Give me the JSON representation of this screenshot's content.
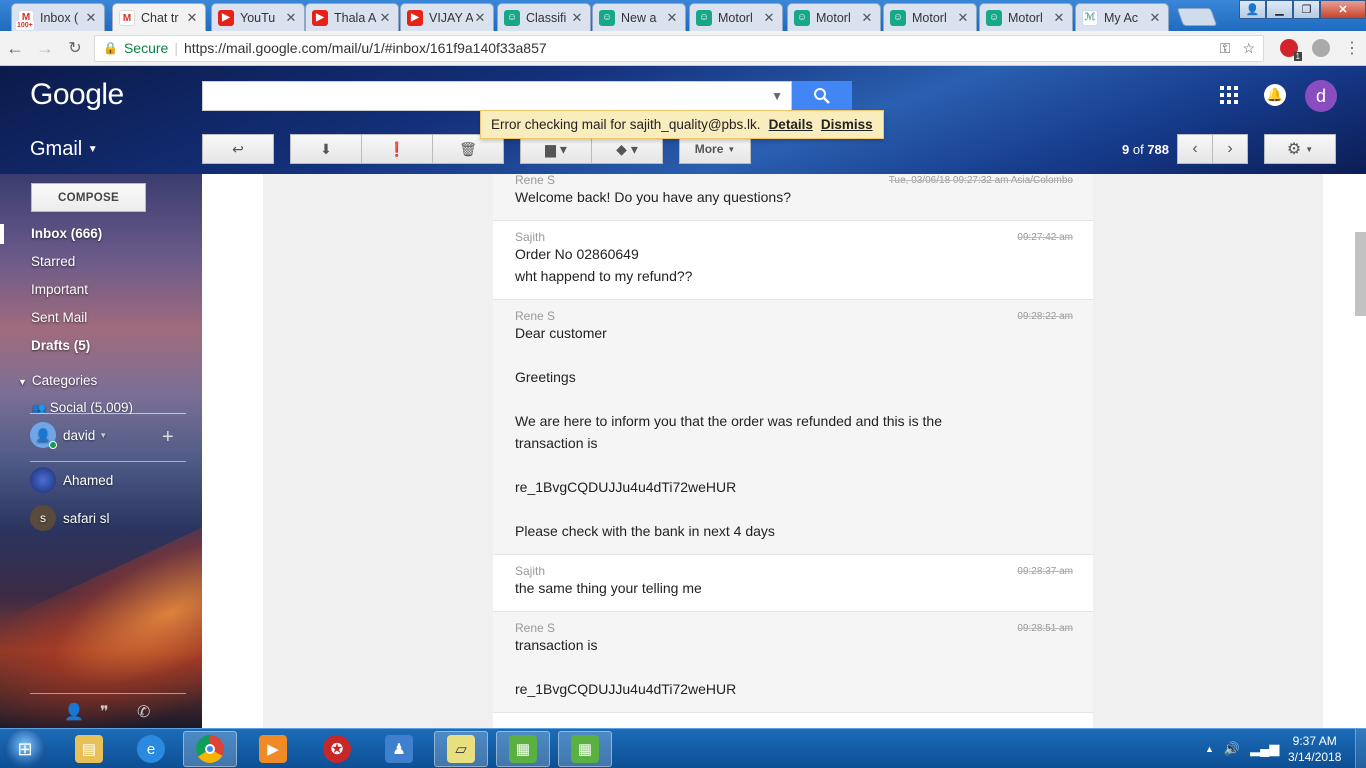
{
  "browser": {
    "tabs": [
      {
        "title": "Inbox (",
        "favicon": "gmail-icon",
        "badge": "100+"
      },
      {
        "title": "Chat tr",
        "favicon": "gmail-icon"
      },
      {
        "title": "YouTu",
        "favicon": "youtube-icon"
      },
      {
        "title": "Thala A",
        "favicon": "youtube-icon"
      },
      {
        "title": "VIJAY A",
        "favicon": "youtube-icon"
      },
      {
        "title": "Classifi",
        "favicon": "app-icon"
      },
      {
        "title": "New a",
        "favicon": "app-icon"
      },
      {
        "title": "Motorl",
        "favicon": "app-icon"
      },
      {
        "title": "Motorl",
        "favicon": "app-icon"
      },
      {
        "title": "Motorl",
        "favicon": "app-icon"
      },
      {
        "title": "Motorl",
        "favicon": "app-icon"
      },
      {
        "title": "My Ac",
        "favicon": "leaf-icon"
      }
    ],
    "secure_label": "Secure",
    "url": "https://mail.google.com/mail/u/1/#inbox/161f9a140f33a857",
    "extension_badge": "1"
  },
  "gmail": {
    "logo": "Google",
    "app_label": "Gmail",
    "avatar_letter": "d",
    "more_label": "More",
    "counter": {
      "range": "9",
      "of": "of",
      "total": "788"
    },
    "alert": {
      "text": "Error checking mail for sajith_quality@pbs.lk.",
      "details": "Details",
      "dismiss": "Dismiss"
    }
  },
  "sidebar": {
    "compose": "COMPOSE",
    "items": [
      {
        "label": "Inbox (666)",
        "bold": true
      },
      {
        "label": "Starred",
        "bold": false
      },
      {
        "label": "Important",
        "bold": false
      },
      {
        "label": "Sent Mail",
        "bold": false
      },
      {
        "label": "Drafts (5)",
        "bold": true
      }
    ],
    "categories": "Categories",
    "social": "Social (5,009)",
    "me": "david",
    "contacts": [
      {
        "name": "Ahamed"
      },
      {
        "name": "safari sl",
        "initial": "s"
      }
    ]
  },
  "thread": [
    {
      "sender": "Rene S",
      "time": "Tue, 03/06/18 09:27:32 am Asia/Colombo",
      "lines": [
        "Welcome back! Do you have any questions?"
      ],
      "alt": true
    },
    {
      "sender": "Sajith",
      "time": "09:27:42 am",
      "lines": [
        "Order No 02860649",
        "wht happend to my refund??"
      ],
      "alt": false
    },
    {
      "sender": "Rene S",
      "time": "09:28:22 am",
      "lines": [
        "Dear customer",
        "",
        "Greetings",
        "",
        "We are here to inform you that the order was refunded and this is the",
        "transaction is",
        "",
        "re_1BvgCQDUJJu4u4dTi72weHUR",
        "",
        "Please check with the bank in next 4 days"
      ],
      "alt": true
    },
    {
      "sender": "Sajith",
      "time": "09:28:37 am",
      "lines": [
        "the same thing your telling me"
      ],
      "alt": false
    },
    {
      "sender": "Rene S",
      "time": "09:28:51 am",
      "lines": [
        "transaction is",
        "",
        "re_1BvgCQDUJJu4u4dTi72weHUR"
      ],
      "alt": true
    }
  ],
  "taskbar": {
    "time": "9:37 AM",
    "date": "3/14/2018"
  }
}
